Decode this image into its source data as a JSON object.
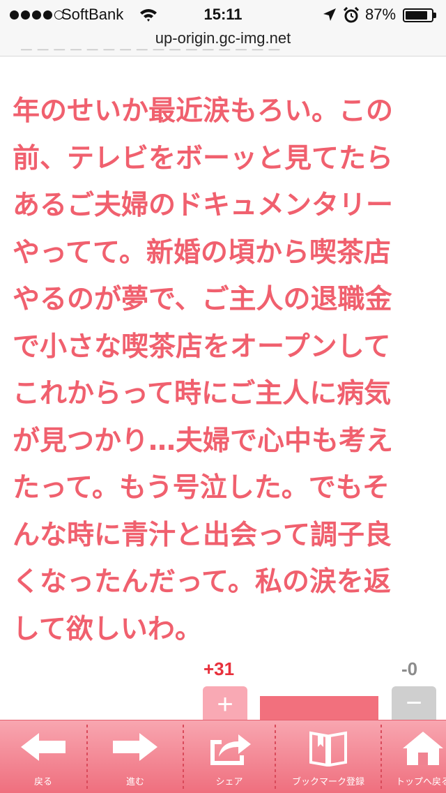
{
  "status_bar": {
    "carrier": "SoftBank",
    "time": "15:11",
    "battery_percent": "87%",
    "battery_level": 0.87
  },
  "url_bar": {
    "url": "up-origin.gc-img.net"
  },
  "comment": {
    "lines": [
      "年のせいか最近涙もろい。この",
      "前、テレビをボーッと見てたら",
      "あるご夫婦のドキュメンタリー",
      "やってて。新婚の頃から喫茶店",
      "やるのが夢で、ご主人の退職金",
      "で小さな喫茶店をオープンして",
      "これからって時にご主人に病気",
      "が見つかり…夫婦で心中も考え",
      "たって。もう号泣した。でもそ",
      "んな時に青汁と出会って調子良",
      "くなったんだって。私の涙を返",
      "して欲しいわ。"
    ]
  },
  "vote": {
    "plus_count": "+31",
    "minus_count": "-0",
    "plus_symbol": "+",
    "minus_symbol": "−"
  },
  "toolbar": {
    "items": [
      {
        "label": "戻る",
        "icon": "arrow-left-icon"
      },
      {
        "label": "進む",
        "icon": "arrow-right-icon"
      },
      {
        "label": "シェア",
        "icon": "share-icon"
      },
      {
        "label": "ブックマーク登録",
        "icon": "book-icon"
      },
      {
        "label": "トップへ戻る",
        "icon": "home-icon"
      }
    ]
  },
  "colors": {
    "comment_text": "#f0606e",
    "plus_count": "#e8303c",
    "toolbar": "#f08391"
  }
}
